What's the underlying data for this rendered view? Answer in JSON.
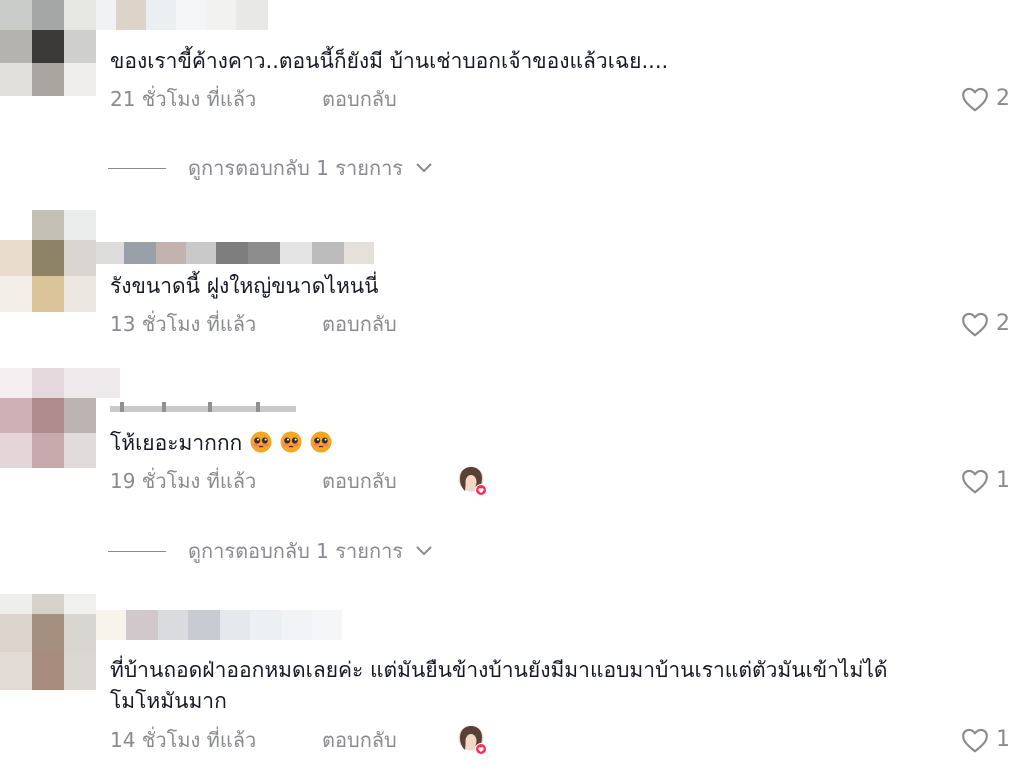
{
  "comments": [
    {
      "text": "ของเราขี้ค้างคาว..ตอนนี้ก็ยังมี บ้านเช่าบอกเจ้าของแล้วเฉย....",
      "time": "21 ชั่วโมง ที่แล้ว",
      "reply": "ตอบกลับ",
      "likes": "2"
    },
    {
      "text": "รังขนาดนี้ ฝูงใหญ่ขนาดไหนนี่",
      "time": "13 ชั่วโมง ที่แล้ว",
      "reply": "ตอบกลับ",
      "likes": "2"
    },
    {
      "text": "โห้เยอะมากกก",
      "time": "19 ชั่วโมง ที่แล้ว",
      "reply": "ตอบกลับ",
      "likes": "1"
    },
    {
      "text_line1": "ที่บ้านถอดฝ่าออกหมดเลยค่ะ แต่มันยืนข้างบ้านยังมีมาแอบมาบ้านเราแต่ตัวมันเข้าไม่ได้",
      "text_line2": "โมโหมันมาก",
      "time": "14 ชั่วโมง ที่แล้ว",
      "reply": "ตอบกลับ",
      "likes": "1"
    }
  ],
  "view_replies": [
    "ดูการตอบกลับ 1 รายการ",
    "ดูการตอบกลับ 1 รายการ"
  ],
  "icons": {
    "like": "heart-outline-icon",
    "expand": "chevron-down-icon",
    "creator_liked": "creator-liked-avatar",
    "emoji": "pleading-face-emoji"
  },
  "colors": {
    "text": "#161823",
    "secondary": "#8a8b91",
    "creator_heart": "#fe2c55"
  }
}
